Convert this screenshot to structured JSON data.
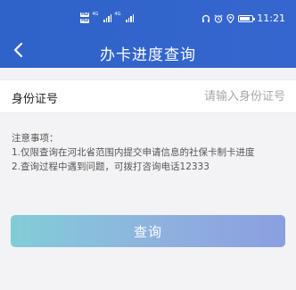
{
  "status_bar": {
    "hd_top": "HD",
    "hd_bottom": "HD",
    "sig1_label": "4G",
    "sig2_label": "4G",
    "time": "11:21",
    "icons": [
      "headset-icon",
      "alarm-icon",
      "location-icon",
      "battery-icon"
    ]
  },
  "header": {
    "title": "办卡进度查询",
    "back_icon": "chevron-left-icon"
  },
  "form": {
    "id_label": "身份证号",
    "id_placeholder": "请输入身份证号",
    "id_value": ""
  },
  "notes": {
    "heading": "注意事项：",
    "items": [
      "1.仅限查询在河北省范围内提交申请信息的社保卡制卡进度",
      "2.查询过程中遇到问题，可拨打咨询电话12333"
    ]
  },
  "actions": {
    "query_label": "查询"
  },
  "colors": {
    "header_blue": "#3566cf",
    "button_gradient_start": "#82cdd8",
    "button_gradient_end": "#8b9fe0",
    "page_bg": "#f3f3f5"
  }
}
